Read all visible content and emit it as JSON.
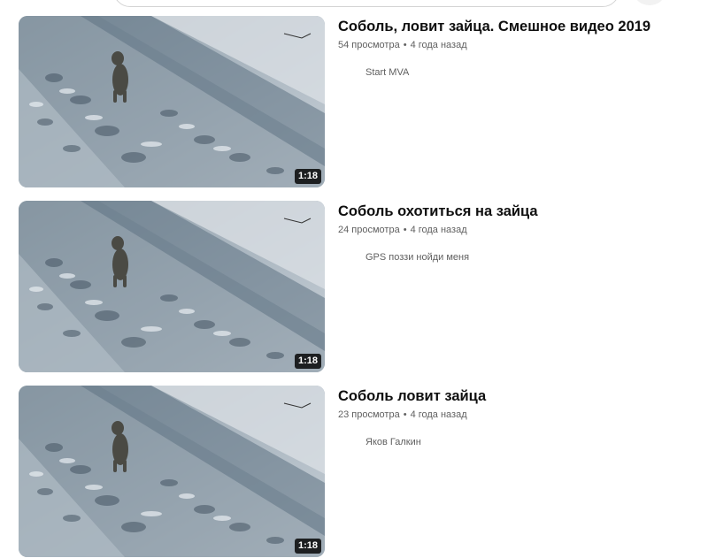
{
  "results": [
    {
      "title": "Соболь, ловит зайца. Смешное видео 2019",
      "views": "54 просмотра",
      "age": "4 года назад",
      "channel": "Start MVA",
      "duration": "1:18"
    },
    {
      "title": "Соболь охотиться на зайца",
      "views": "24 просмотра",
      "age": "4 года назад",
      "channel": "GPS поззи нойди меня",
      "duration": "1:18"
    },
    {
      "title": "Соболь ловит зайца",
      "views": "23 просмотра",
      "age": "4 года назад",
      "channel": "Яков Галкин",
      "duration": "1:18"
    }
  ],
  "icons": {
    "thumbnail": "snowy-trail-animal-image"
  }
}
